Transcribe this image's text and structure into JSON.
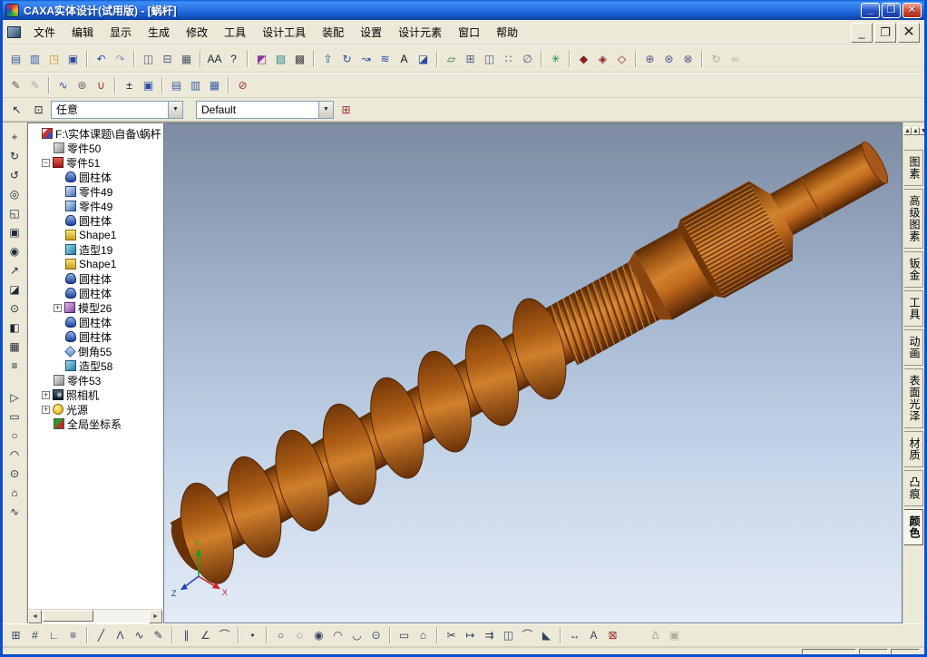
{
  "window": {
    "title": "CAXA实体设计(试用版) - [蜗杆]",
    "controls": {
      "minimize": "_",
      "maximize": "❐",
      "close": "✕"
    }
  },
  "mdi_controls": {
    "minimize": "_",
    "restore": "❐",
    "close": "✕"
  },
  "menu": {
    "items": [
      {
        "label": "文件",
        "key": "file"
      },
      {
        "label": "编辑",
        "key": "edit"
      },
      {
        "label": "显示",
        "key": "display"
      },
      {
        "label": "生成",
        "key": "generate"
      },
      {
        "label": "修改",
        "key": "modify"
      },
      {
        "label": "工具",
        "key": "tools"
      },
      {
        "label": "设计工具",
        "key": "design-tools"
      },
      {
        "label": "装配",
        "key": "assembly"
      },
      {
        "label": "设置",
        "key": "settings"
      },
      {
        "label": "设计元素",
        "key": "design-elements"
      },
      {
        "label": "窗口",
        "key": "window"
      },
      {
        "label": "帮助",
        "key": "help"
      }
    ]
  },
  "selection_bar": {
    "filter_value": "任意",
    "style_value": "Default"
  },
  "toolbars": {
    "standard": [
      {
        "name": "new-file-icon",
        "glyph": "▤",
        "color": "#3a5fa8"
      },
      {
        "name": "template-file-icon",
        "glyph": "▥",
        "color": "#3a5fa8"
      },
      {
        "name": "open-file-icon",
        "glyph": "◳",
        "color": "#c79418"
      },
      {
        "name": "save-file-icon",
        "glyph": "▣",
        "color": "#2b4da0"
      },
      {
        "sep": true
      },
      {
        "name": "undo-icon",
        "glyph": "↶",
        "color": "#2b4da0"
      },
      {
        "name": "redo-icon",
        "glyph": "↷",
        "color": "#8a98b8"
      },
      {
        "sep": true
      },
      {
        "name": "copy-icon",
        "glyph": "◫",
        "color": "#4a5a84"
      },
      {
        "name": "paste-icon",
        "glyph": "⊟",
        "color": "#4a5a84"
      },
      {
        "name": "print-icon",
        "glyph": "▦",
        "color": "#50586a"
      },
      {
        "sep": true
      },
      {
        "name": "find-text-icon",
        "glyph": "AA",
        "color": "#202838"
      },
      {
        "name": "help-icon",
        "glyph": "?",
        "color": "#202838"
      },
      {
        "sep": true
      },
      {
        "name": "smart-render-icon",
        "glyph": "◩",
        "color": "#8a3a9a"
      },
      {
        "name": "scene-icon",
        "glyph": "▧",
        "color": "#2a8a8a"
      },
      {
        "name": "display-mode-icon",
        "glyph": "▩",
        "color": "#444444"
      },
      {
        "sep": true
      },
      {
        "name": "extrude-icon",
        "glyph": "⇧",
        "color": "#2b4da0"
      },
      {
        "name": "revolve-icon",
        "glyph": "↻",
        "color": "#2b4da0"
      },
      {
        "name": "sweep-icon",
        "glyph": "↝",
        "color": "#2b4da0"
      },
      {
        "name": "loft-icon",
        "glyph": "≋",
        "color": "#2b4da0"
      },
      {
        "name": "text-tool-icon",
        "glyph": "A",
        "color": "#111111"
      },
      {
        "name": "surface-icon",
        "glyph": "◪",
        "color": "#2b4da0"
      },
      {
        "sep": true
      },
      {
        "name": "datum-plane-icon",
        "glyph": "▱",
        "color": "#2a7a3a"
      },
      {
        "name": "pattern-icon",
        "glyph": "⊞",
        "color": "#4a5a84"
      },
      {
        "name": "mirror-feature-icon",
        "glyph": "◫",
        "color": "#4a5a84"
      },
      {
        "name": "array-icon",
        "glyph": "∷",
        "color": "#4a5a84"
      },
      {
        "name": "measure-icon",
        "glyph": "∅",
        "color": "#4a5a84"
      },
      {
        "sep": true
      },
      {
        "name": "animation-icon",
        "glyph": "✳",
        "color": "#18953a"
      },
      {
        "sep": true
      },
      {
        "name": "shaded-mode-icon",
        "glyph": "◆",
        "color": "#8a2020"
      },
      {
        "name": "hidden-line-icon",
        "glyph": "◈",
        "color": "#8a2020"
      },
      {
        "name": "wireframe-mode-icon",
        "glyph": "◇",
        "color": "#8a2020"
      },
      {
        "sep": true
      },
      {
        "name": "assemble-icon",
        "glyph": "⊕",
        "color": "#4a5a84"
      },
      {
        "name": "constraint-icon",
        "glyph": "⊛",
        "color": "#4a5a84"
      },
      {
        "name": "explode-icon",
        "glyph": "⊗",
        "color": "#4a5a84"
      },
      {
        "sep": true
      },
      {
        "name": "update-icon",
        "glyph": "↻",
        "color": "#9a9889",
        "disabled": true
      },
      {
        "name": "link-icon",
        "glyph": "∞",
        "color": "#9a9889",
        "disabled": true
      }
    ],
    "secondary": [
      {
        "name": "edit-sketch-icon",
        "glyph": "✎",
        "color": "#555555"
      },
      {
        "name": "edit-surface-icon",
        "glyph": "✎",
        "color": "#a8a8a8"
      },
      {
        "sep": true
      },
      {
        "name": "spring-tool-icon",
        "glyph": "∿",
        "color": "#2b4da0"
      },
      {
        "name": "gear-tool-icon",
        "glyph": "⊛",
        "color": "#666666"
      },
      {
        "name": "magnet-tool-icon",
        "glyph": "∪",
        "color": "#a03030"
      },
      {
        "sep": true
      },
      {
        "name": "tolerance-icon",
        "glyph": "±",
        "color": "#202838"
      },
      {
        "name": "frame-icon",
        "glyph": "▣",
        "color": "#2b4da0"
      },
      {
        "sep": true
      },
      {
        "name": "view-front-icon",
        "glyph": "▤",
        "color": "#3a5fa8"
      },
      {
        "name": "view-side-icon",
        "glyph": "▥",
        "color": "#3a5fa8"
      },
      {
        "name": "view-top-icon",
        "glyph": "▦",
        "color": "#3a5fa8"
      },
      {
        "sep": true
      },
      {
        "name": "no-render-icon",
        "glyph": "⊘",
        "color": "#a03030"
      }
    ],
    "left": [
      {
        "name": "pan-view-icon",
        "glyph": "+",
        "color": "#202838"
      },
      {
        "name": "rotate-view-icon",
        "glyph": "↻",
        "color": "#202838"
      },
      {
        "name": "spin-view-icon",
        "glyph": "↺",
        "color": "#202838"
      },
      {
        "name": "zoom-view-icon",
        "glyph": "◎",
        "color": "#202838"
      },
      {
        "name": "zoom-window-icon",
        "glyph": "◱",
        "color": "#202838"
      },
      {
        "name": "fit-view-icon",
        "glyph": "▣",
        "color": "#202838"
      },
      {
        "name": "target-view-icon",
        "glyph": "◉",
        "color": "#202838"
      },
      {
        "name": "fly-view-icon",
        "glyph": "↗",
        "color": "#202838"
      },
      {
        "name": "camera-view-icon",
        "glyph": "◪",
        "color": "#202838"
      },
      {
        "name": "look-at-icon",
        "glyph": "⊙",
        "color": "#202838"
      },
      {
        "name": "render-style-icon",
        "glyph": "◧",
        "color": "#202838"
      },
      {
        "name": "snapshot-icon",
        "glyph": "▦",
        "color": "#202838"
      },
      {
        "name": "view-settings-icon",
        "glyph": "≡",
        "color": "#202838"
      },
      {
        "gap": true
      },
      {
        "name": "select-2d-icon",
        "glyph": "▷",
        "color": "#202838"
      },
      {
        "name": "rect-2d-icon",
        "glyph": "▭",
        "color": "#202838"
      },
      {
        "name": "circle-2d-icon",
        "glyph": "○",
        "color": "#202838"
      },
      {
        "name": "arc-2d-icon",
        "glyph": "◠",
        "color": "#202838"
      },
      {
        "name": "ellipse-2d-icon",
        "glyph": "⊙",
        "color": "#202838"
      },
      {
        "name": "polygon-2d-icon",
        "glyph": "⌂",
        "color": "#202838"
      },
      {
        "name": "spline-2d-icon",
        "glyph": "∿",
        "color": "#202838"
      }
    ],
    "bottom": [
      {
        "name": "grid-toggle-icon",
        "glyph": "⊞",
        "color": "#33425e"
      },
      {
        "name": "snap-toggle-icon",
        "glyph": "#",
        "color": "#33425e"
      },
      {
        "name": "ortho-toggle-icon",
        "glyph": "∟",
        "color": "#33425e"
      },
      {
        "name": "layers-icon",
        "glyph": "≡",
        "color": "#33425e"
      },
      {
        "sep": true
      },
      {
        "name": "line-tool-icon",
        "glyph": "╱",
        "color": "#33425e"
      },
      {
        "name": "polyline-tool-icon",
        "glyph": "Λ",
        "color": "#33425e"
      },
      {
        "name": "spline-tool-icon",
        "glyph": "∿",
        "color": "#33425e"
      },
      {
        "name": "sketch-pencil-icon",
        "glyph": "✎",
        "color": "#33425e"
      },
      {
        "sep": true
      },
      {
        "name": "parallel-line-icon",
        "glyph": "∥",
        "color": "#33425e"
      },
      {
        "name": "angle-line-icon",
        "glyph": "∠",
        "color": "#33425e"
      },
      {
        "name": "tangent-arc-icon",
        "glyph": "⌒",
        "color": "#33425e"
      },
      {
        "sep": true
      },
      {
        "name": "point-tool-icon",
        "glyph": "•",
        "color": "#33425e"
      },
      {
        "sep": true
      },
      {
        "name": "circle-center-icon",
        "glyph": "○",
        "color": "#33425e"
      },
      {
        "name": "circle-2pt-icon",
        "glyph": "◌",
        "color": "#33425e"
      },
      {
        "name": "circle-3pt-icon",
        "glyph": "◉",
        "color": "#33425e"
      },
      {
        "name": "arc-tool-icon",
        "glyph": "◠",
        "color": "#33425e"
      },
      {
        "name": "arc-3pt-icon",
        "glyph": "◡",
        "color": "#33425e"
      },
      {
        "name": "ellipse-tool-icon",
        "glyph": "⊙",
        "color": "#33425e"
      },
      {
        "sep": true
      },
      {
        "name": "rectangle-tool-icon",
        "glyph": "▭",
        "color": "#33425e"
      },
      {
        "name": "polygon-tool-icon",
        "glyph": "⌂",
        "color": "#33425e"
      },
      {
        "sep": true
      },
      {
        "name": "trim-tool-icon",
        "glyph": "✂",
        "color": "#33425e"
      },
      {
        "name": "extend-tool-icon",
        "glyph": "↦",
        "color": "#33425e"
      },
      {
        "name": "offset-tool-icon",
        "glyph": "⇉",
        "color": "#33425e"
      },
      {
        "name": "mirror-tool-icon",
        "glyph": "◫",
        "color": "#33425e"
      },
      {
        "name": "fillet-2d-icon",
        "glyph": "⌒",
        "color": "#33425e"
      },
      {
        "name": "chamfer-2d-icon",
        "glyph": "◣",
        "color": "#33425e"
      },
      {
        "sep": true
      },
      {
        "name": "dimension-tool-icon",
        "glyph": "↔",
        "color": "#33425e"
      },
      {
        "name": "text-2d-icon",
        "glyph": "A",
        "color": "#33425e"
      },
      {
        "name": "erase-tool-icon",
        "glyph": "⊠",
        "color": "#a03030"
      },
      {
        "gap": true
      },
      {
        "name": "view-plane-icon",
        "glyph": "∆",
        "color": "#9a9889",
        "disabled": true
      },
      {
        "name": "view-lock-icon",
        "glyph": "▣",
        "color": "#9a9889",
        "disabled": true
      }
    ]
  },
  "tree": {
    "root": {
      "label": "F:\\实体课题\\自备\\蜗杆.ic",
      "icon": "doc-red"
    },
    "nodes": [
      {
        "label": "零件50",
        "icon": "part-gray"
      },
      {
        "label": "零件51",
        "icon": "part-red",
        "expand": "minus",
        "children": [
          {
            "label": "圆柱体",
            "icon": "cylinder"
          },
          {
            "label": "零件49",
            "icon": "box"
          },
          {
            "label": "零件49",
            "icon": "box"
          },
          {
            "label": "圆柱体",
            "icon": "cylinder"
          },
          {
            "label": "Shape1",
            "icon": "shape"
          },
          {
            "label": "造型19",
            "icon": "feature"
          },
          {
            "label": "Shape1",
            "icon": "shape"
          },
          {
            "label": "圆柱体",
            "icon": "cylinder"
          },
          {
            "label": "圆柱体",
            "icon": "cylinder"
          },
          {
            "label": "模型26",
            "icon": "model",
            "expand": "plus"
          },
          {
            "label": "圆柱体",
            "icon": "cylinder"
          },
          {
            "label": "圆柱体",
            "icon": "cylinder"
          },
          {
            "label": "倒角55",
            "icon": "chamfer"
          },
          {
            "label": "造型58",
            "icon": "feature"
          }
        ]
      },
      {
        "label": "零件53",
        "icon": "part-gray"
      },
      {
        "label": "照相机",
        "icon": "camera",
        "expand": "plus"
      },
      {
        "label": "光源",
        "icon": "light",
        "expand": "plus"
      },
      {
        "label": "全局坐标系",
        "icon": "axes"
      }
    ]
  },
  "side_tabs": [
    {
      "label": "图素",
      "key": "elements"
    },
    {
      "label": "高级图素",
      "key": "advanced-elements"
    },
    {
      "label": "钣金",
      "key": "sheet-metal"
    },
    {
      "label": "工具",
      "key": "tools"
    },
    {
      "label": "动画",
      "key": "animation"
    },
    {
      "label": "表面光泽",
      "key": "surface-finish"
    },
    {
      "label": "材质",
      "key": "material"
    },
    {
      "label": "凸痕",
      "key": "bump"
    },
    {
      "label": "颜色",
      "key": "color",
      "selected": true
    }
  ],
  "scroll_buttons": [
    {
      "key": "up-1",
      "glyph": "▲"
    },
    {
      "key": "up-2",
      "glyph": "▲"
    },
    {
      "key": "down-1",
      "glyph": "▼"
    },
    {
      "key": "down-2",
      "glyph": "▼"
    }
  ],
  "viewport": {
    "axes": {
      "x": "X",
      "y": "Y",
      "z": "Z"
    }
  }
}
